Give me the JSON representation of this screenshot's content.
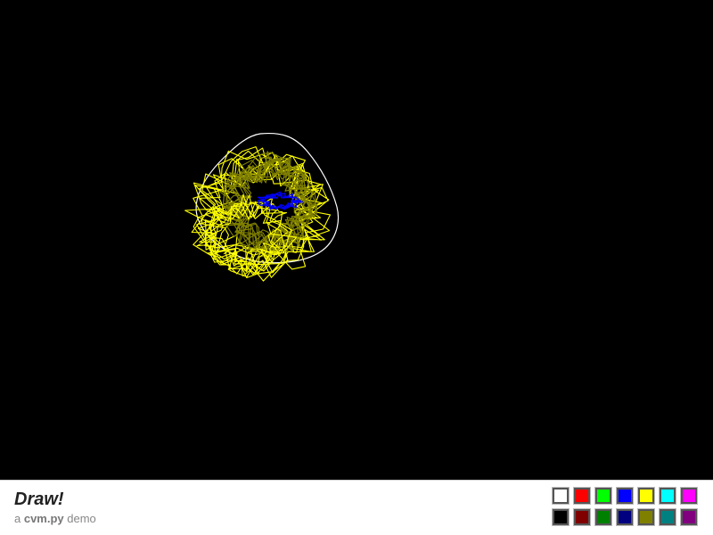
{
  "app": {
    "title": "Draw!",
    "subtitle_prefix": "a ",
    "subtitle_lib": "cvm.py",
    "subtitle_suffix": " demo"
  },
  "canvas": {
    "background": "#000000"
  },
  "palette": {
    "selected_color": "#ffffff",
    "rows": [
      [
        "#ffffff",
        "#ff0000",
        "#00ff00",
        "#0000ff",
        "#ffff00",
        "#00ffff",
        "#ff00ff"
      ],
      [
        "#000000",
        "#800000",
        "#008000",
        "#000080",
        "#808000",
        "#008080",
        "#800080"
      ]
    ]
  },
  "strokes": [
    {
      "color": "#ffff00",
      "kind": "scribble"
    },
    {
      "color": "#808000",
      "kind": "scribble"
    },
    {
      "color": "#ffffff",
      "kind": "outline"
    },
    {
      "color": "#0000ff",
      "kind": "scribble"
    }
  ]
}
